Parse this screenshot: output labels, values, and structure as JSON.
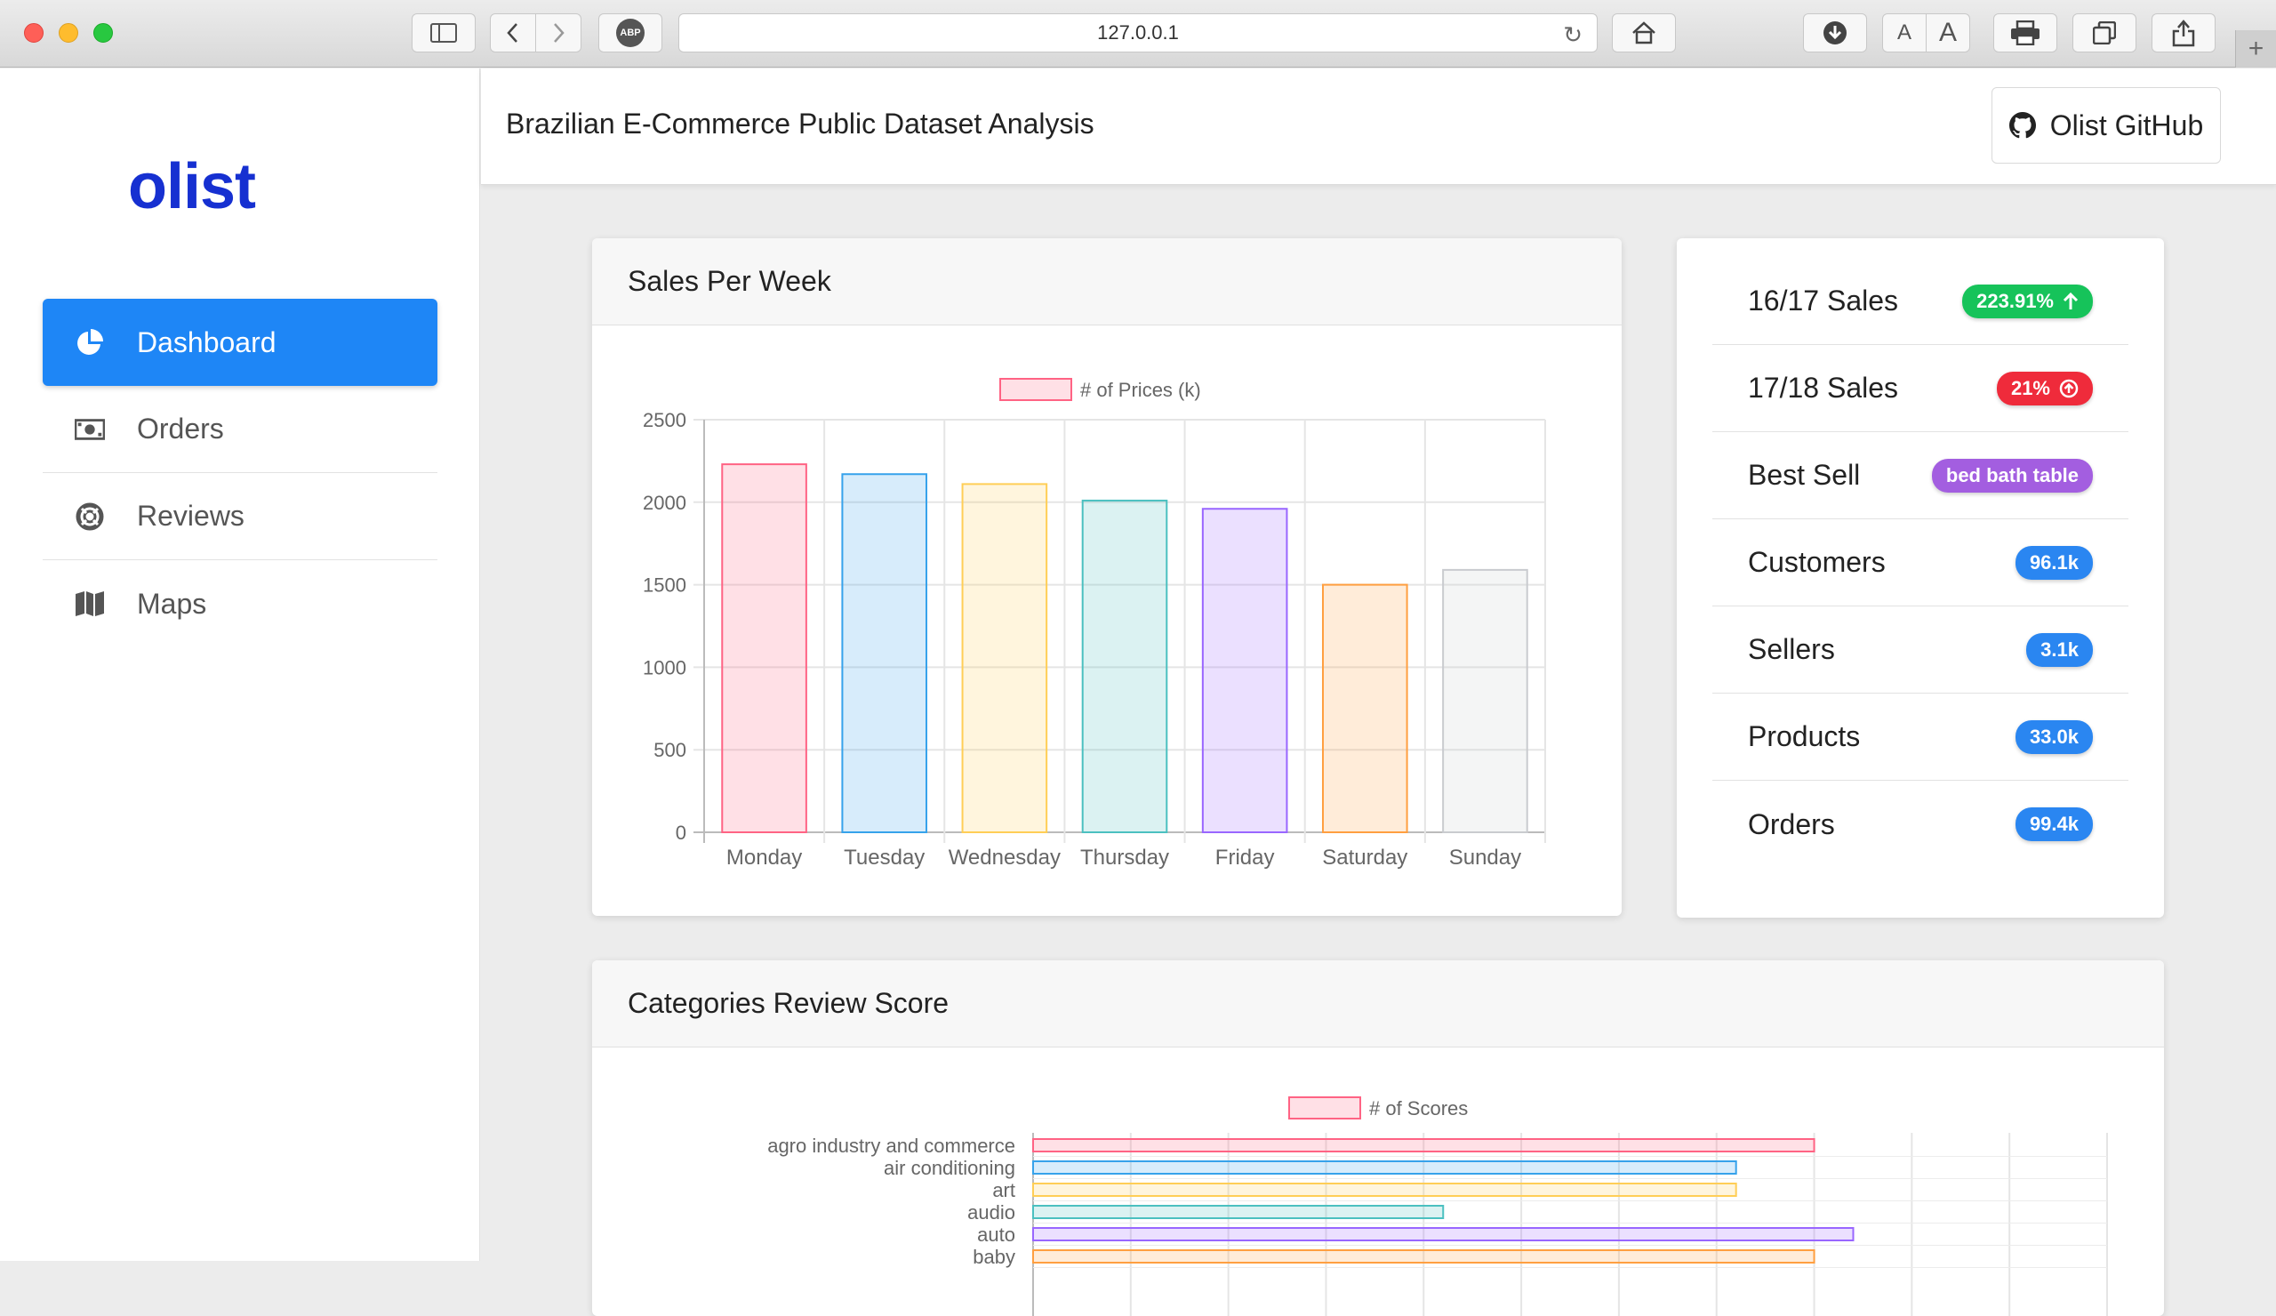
{
  "browser": {
    "url": "127.0.0.1",
    "text_small": "A",
    "text_large": "A",
    "adblock_label": "ABP"
  },
  "sidebar": {
    "logo": "olist",
    "items": [
      {
        "label": "Dashboard",
        "icon": "pie-chart-icon",
        "active": true
      },
      {
        "label": "Orders",
        "icon": "money-bill-icon"
      },
      {
        "label": "Reviews",
        "icon": "life-ring-icon"
      },
      {
        "label": "Maps",
        "icon": "map-icon"
      }
    ]
  },
  "header": {
    "title": "Brazilian E-Commerce Public Dataset Analysis",
    "github_label": "Olist GitHub"
  },
  "sales_card": {
    "title": "Sales Per Week"
  },
  "review_card": {
    "title": "Categories Review Score"
  },
  "stats": [
    {
      "label": "16/17 Sales",
      "value": "223.91%",
      "color": "#16c35a",
      "icon": "arrow-up-icon"
    },
    {
      "label": "17/18 Sales",
      "value": "21%",
      "color": "#ef2b3b",
      "icon": "arrow-circle-up-icon"
    },
    {
      "label": "Best Sell",
      "value": "bed bath table",
      "color": "#a35ee0"
    },
    {
      "label": "Customers",
      "value": "96.1k",
      "color": "#2a86f1"
    },
    {
      "label": "Sellers",
      "value": "3.1k",
      "color": "#2a86f1"
    },
    {
      "label": "Products",
      "value": "33.0k",
      "color": "#2a86f1"
    },
    {
      "label": "Orders",
      "value": "99.4k",
      "color": "#2a86f1"
    }
  ],
  "chart_data": [
    {
      "type": "bar",
      "title": "",
      "legend": [
        "# of Prices (k)"
      ],
      "legend_position": "top",
      "categories": [
        "Monday",
        "Tuesday",
        "Wednesday",
        "Thursday",
        "Friday",
        "Saturday",
        "Sunday"
      ],
      "series": [
        {
          "name": "# of Prices (k)",
          "values": [
            2230,
            2170,
            2110,
            2010,
            1960,
            1500,
            1590
          ]
        }
      ],
      "ylim": [
        0,
        2500
      ],
      "yticks": [
        0,
        500,
        1000,
        1500,
        2000,
        2500
      ],
      "grid": true,
      "colors": [
        "#ff6384",
        "#36a2eb",
        "#ffce56",
        "#4bc0c0",
        "#9966ff",
        "#ff9f40",
        "#c9cbcf"
      ]
    },
    {
      "type": "bar",
      "orientation": "horizontal",
      "title": "",
      "legend": [
        "# of Scores"
      ],
      "legend_position": "top",
      "categories": [
        "agro industry and commerce",
        "air conditioning",
        "art",
        "audio",
        "auto",
        "baby"
      ],
      "series": [
        {
          "name": "# of Scores",
          "values": [
            4.0,
            3.6,
            3.6,
            2.1,
            4.2,
            4.0
          ]
        }
      ],
      "xlim": [
        0,
        5.5
      ],
      "grid": true,
      "colors": [
        "#ff6384",
        "#36a2eb",
        "#ffce56",
        "#4bc0c0",
        "#9966ff",
        "#ff9f40"
      ]
    }
  ]
}
